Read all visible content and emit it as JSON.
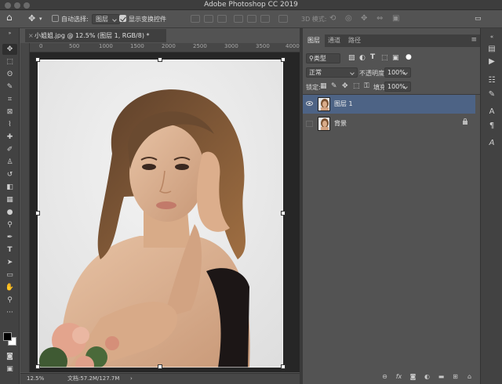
{
  "window": {
    "title": "Adobe Photoshop CC 2019"
  },
  "options_bar": {
    "auto_select_label": "自动选择:",
    "auto_select_value": "图层",
    "show_transform_label": "显示变换控件",
    "mode_3d_label": "3D 模式:"
  },
  "document": {
    "tab_title": "小姐姐.jpg @ 12.5% (图层 1, RGB/8) *",
    "close_glyph": "×",
    "ruler_h_labels": [
      "0",
      "500",
      "1000",
      "1500",
      "2000",
      "2500",
      "3000",
      "3500",
      "4000"
    ],
    "zoom": "12.5%",
    "doc_size": "文档:57.2M/127.7M"
  },
  "layers_panel": {
    "tabs": [
      "图层",
      "通道",
      "路径"
    ],
    "filter_label": "类型",
    "blend_mode": "正常",
    "opacity_label": "不透明度:",
    "opacity_value": "100%",
    "lock_label": "锁定:",
    "fill_label": "填充:",
    "fill_value": "100%",
    "layers": [
      {
        "name": "图层 1",
        "visible": true,
        "selected": true,
        "locked": false
      },
      {
        "name": "背景",
        "visible": false,
        "selected": false,
        "locked": true
      }
    ],
    "bottom_icons": [
      "link-icon",
      "fx-icon",
      "mask-icon",
      "adjustment-icon",
      "group-icon",
      "new-layer-icon",
      "trash-icon"
    ]
  },
  "colors": {
    "selected_layer": "#4d6385",
    "panel_bg": "#535353",
    "toolbar_bg": "#424242"
  }
}
